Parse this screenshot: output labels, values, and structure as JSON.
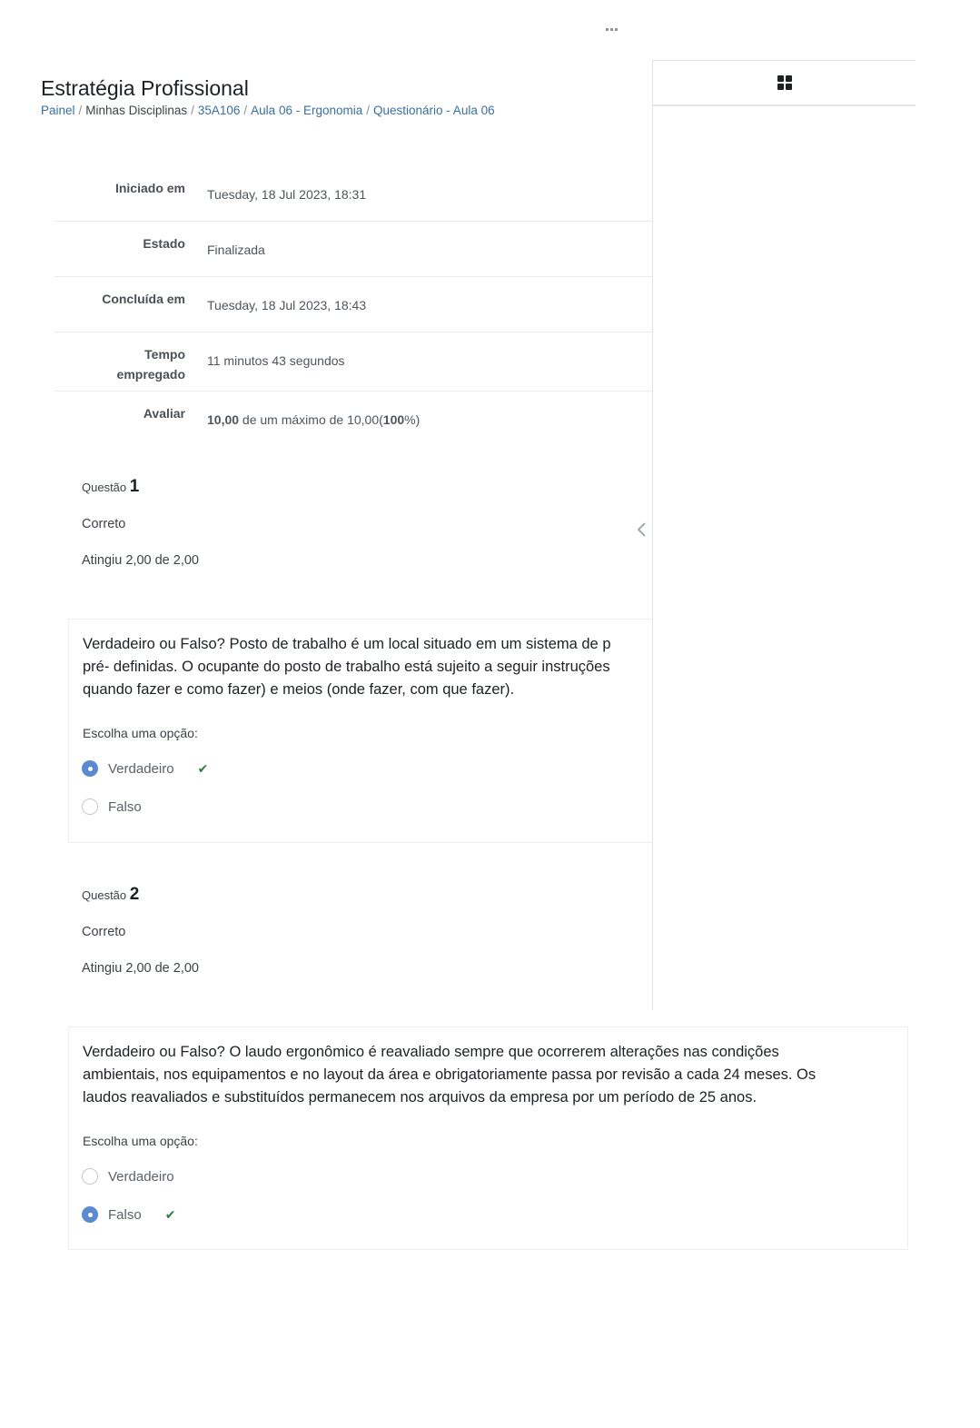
{
  "header": {
    "title": "Estratégia Profissional",
    "breadcrumb": [
      {
        "label": "Painel",
        "link": true
      },
      {
        "label": "Minhas Disciplinas",
        "link": false
      },
      {
        "label": "35A106",
        "link": true
      },
      {
        "label": "Aula 06 - Ergonomia",
        "link": true
      },
      {
        "label": "Questionário - Aula 06",
        "link": true
      }
    ]
  },
  "summary": {
    "started_label": "Iniciado em",
    "started_value": "Tuesday, 18 Jul 2023, 18:31",
    "state_label": "Estado",
    "state_value": "Finalizada",
    "completed_label": "Concluída em",
    "completed_value": "Tuesday, 18 Jul 2023, 18:43",
    "time_label_1": "Tempo",
    "time_label_2": "empregado",
    "time_value": "11 minutos 43 segundos",
    "grade_label": "Avaliar",
    "grade_score": "10,00",
    "grade_mid": " de um máximo de 10,00(",
    "grade_pct": "100",
    "grade_end": "%)"
  },
  "questions": [
    {
      "label": "Questão",
      "number": "1",
      "state": "Correto",
      "grade": "Atingiu 2,00 de 2,00",
      "text": "Verdadeiro ou Falso? Posto de trabalho é um local situado em um sistema de p pré- definidas. O ocupante do posto de trabalho está sujeito a seguir instruções quando fazer e como fazer) e meios (onde fazer, com que fazer).",
      "text_lines": [
        "Verdadeiro ou Falso? Posto de trabalho é um local situado em um sistema de p",
        "pré- definidas. O ocupante do posto de trabalho está sujeito a seguir instruções",
        "quando fazer e como fazer) e meios (onde fazer, com que fazer)."
      ],
      "prompt": "Escolha uma opção:",
      "options": [
        {
          "label": "Verdadeiro",
          "selected": true,
          "correct_mark": true
        },
        {
          "label": "Falso",
          "selected": false,
          "correct_mark": false
        }
      ]
    },
    {
      "label": "Questão",
      "number": "2",
      "state": "Correto",
      "grade": "Atingiu 2,00 de 2,00",
      "text_lines": [
        "Verdadeiro ou Falso? O laudo ergonômico é reavaliado sempre que ocorrerem alterações nas condições",
        "ambientais, nos equipamentos e no layout da área e obrigatoriamente passa por revisão a cada 24 meses. Os",
        "laudos reavaliados e substituídos permanecem nos arquivos da empresa por um período de 25 anos."
      ],
      "prompt": "Escolha uma opção:",
      "options": [
        {
          "label": "Verdadeiro",
          "selected": false,
          "correct_mark": false
        },
        {
          "label": "Falso",
          "selected": true,
          "correct_mark": true
        }
      ]
    }
  ],
  "icons": {
    "more": "more-dots-icon",
    "drawer": "grid-icon",
    "toggle": "chevron-left-icon",
    "check": "check-icon"
  },
  "colors": {
    "link": "#3a6f9e",
    "radio_selected": "#5b8ad0",
    "correct": "#2f7a45"
  }
}
